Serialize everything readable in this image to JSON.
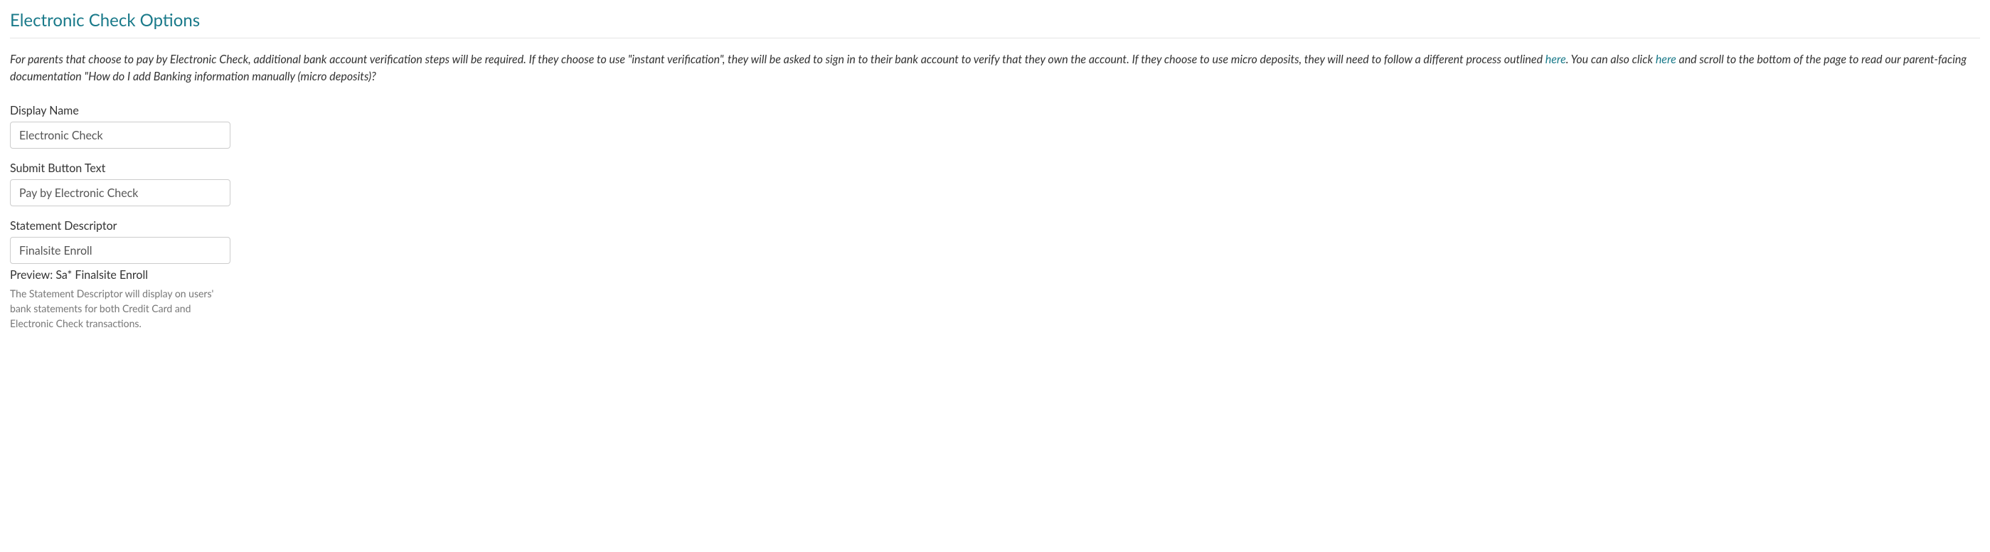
{
  "section": {
    "title": "Electronic Check Options",
    "description": {
      "part1": "For parents that choose to pay by Electronic Check, additional bank account verification steps will be required. If they choose to use \"instant verification\", they will be asked to sign in to their bank account to verify that they own the account. If they choose to use micro deposits, they will need to follow a different process outlined ",
      "link1": "here",
      "part2": ". You can also click ",
      "link2": "here",
      "part3": " and scroll to the bottom of the page to read our parent-facing documentation \"How do I add Banking information manually (micro deposits)?"
    }
  },
  "form": {
    "displayName": {
      "label": "Display Name",
      "value": "Electronic Check"
    },
    "submitButtonText": {
      "label": "Submit Button Text",
      "value": "Pay by Electronic Check"
    },
    "statementDescriptor": {
      "label": "Statement Descriptor",
      "value": "Finalsite Enroll",
      "preview": "Preview: Sa* Finalsite Enroll",
      "helper": "The Statement Descriptor will display on users' bank statements for both Credit Card and Electronic Check transactions."
    }
  }
}
